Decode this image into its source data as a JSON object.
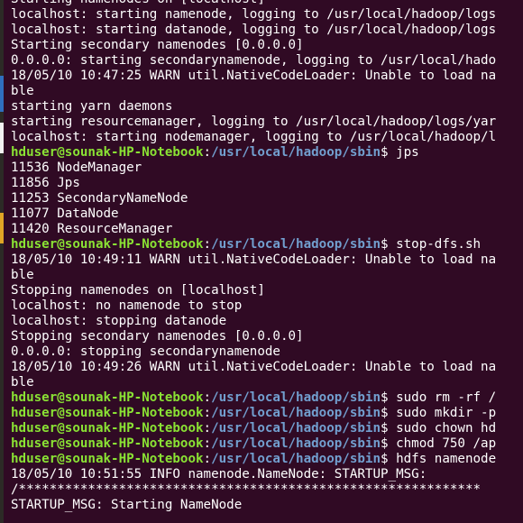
{
  "terminal": {
    "lines": [
      {
        "type": "text",
        "text": "Starting namenodes on [localhost]"
      },
      {
        "type": "text",
        "text": "localhost: starting namenode, logging to /usr/local/hadoop/logs"
      },
      {
        "type": "text",
        "text": "localhost: starting datanode, logging to /usr/local/hadoop/logs"
      },
      {
        "type": "text",
        "text": "Starting secondary namenodes [0.0.0.0]"
      },
      {
        "type": "text",
        "text": "0.0.0.0: starting secondarynamenode, logging to /usr/local/hado"
      },
      {
        "type": "text",
        "text": "18/05/10 10:47:25 WARN util.NativeCodeLoader: Unable to load na"
      },
      {
        "type": "text",
        "text": "ble"
      },
      {
        "type": "text",
        "text": "starting yarn daemons"
      },
      {
        "type": "text",
        "text": "starting resourcemanager, logging to /usr/local/hadoop/logs/yar"
      },
      {
        "type": "text",
        "text": "localhost: starting nodemanager, logging to /usr/local/hadoop/l"
      },
      {
        "type": "prompt",
        "user": "hduser@sounak-HP-Notebook",
        "path": "/usr/local/hadoop/sbin",
        "cmd": " jps"
      },
      {
        "type": "text",
        "text": "11536 NodeManager"
      },
      {
        "type": "text",
        "text": "11856 Jps"
      },
      {
        "type": "text",
        "text": "11253 SecondaryNameNode"
      },
      {
        "type": "text",
        "text": "11077 DataNode"
      },
      {
        "type": "text",
        "text": "11420 ResourceManager"
      },
      {
        "type": "prompt",
        "user": "hduser@sounak-HP-Notebook",
        "path": "/usr/local/hadoop/sbin",
        "cmd": " stop-dfs.sh"
      },
      {
        "type": "text",
        "text": "18/05/10 10:49:11 WARN util.NativeCodeLoader: Unable to load na"
      },
      {
        "type": "text",
        "text": "ble"
      },
      {
        "type": "text",
        "text": "Stopping namenodes on [localhost]"
      },
      {
        "type": "text",
        "text": "localhost: no namenode to stop"
      },
      {
        "type": "text",
        "text": "localhost: stopping datanode"
      },
      {
        "type": "text",
        "text": "Stopping secondary namenodes [0.0.0.0]"
      },
      {
        "type": "text",
        "text": "0.0.0.0: stopping secondarynamenode"
      },
      {
        "type": "text",
        "text": "18/05/10 10:49:26 WARN util.NativeCodeLoader: Unable to load na"
      },
      {
        "type": "text",
        "text": "ble"
      },
      {
        "type": "prompt",
        "user": "hduser@sounak-HP-Notebook",
        "path": "/usr/local/hadoop/sbin",
        "cmd": " sudo rm -rf /"
      },
      {
        "type": "prompt",
        "user": "hduser@sounak-HP-Notebook",
        "path": "/usr/local/hadoop/sbin",
        "cmd": " sudo mkdir -p"
      },
      {
        "type": "prompt",
        "user": "hduser@sounak-HP-Notebook",
        "path": "/usr/local/hadoop/sbin",
        "cmd": " sudo chown hd"
      },
      {
        "type": "prompt",
        "user": "hduser@sounak-HP-Notebook",
        "path": "/usr/local/hadoop/sbin",
        "cmd": " chmod 750 /ap"
      },
      {
        "type": "prompt",
        "user": "hduser@sounak-HP-Notebook",
        "path": "/usr/local/hadoop/sbin",
        "cmd": " hdfs namenode"
      },
      {
        "type": "text",
        "text": "18/05/10 10:51:55 INFO namenode.NameNode: STARTUP_MSG:"
      },
      {
        "type": "text",
        "text": "/************************************************************"
      },
      {
        "type": "text",
        "text": "STARTUP_MSG: Starting NameNode"
      }
    ]
  },
  "colors": {
    "background": "#300a24",
    "text": "#ffffff",
    "prompt_user": "#8ae234",
    "prompt_path": "#729fcf",
    "launcher_accents": [
      "#2f6fbf",
      "#f2f2f2",
      "#e0a526"
    ]
  }
}
